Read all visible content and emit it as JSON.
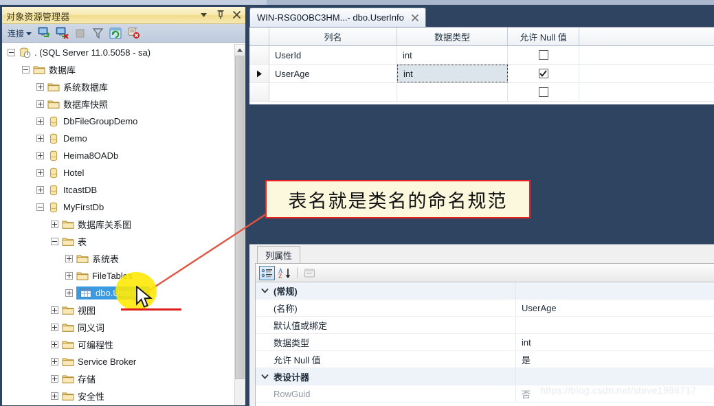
{
  "object_explorer": {
    "title": "对象资源管理器",
    "header_buttons": [
      {
        "name": "dropdown",
        "icon": "chevron-down-icon"
      },
      {
        "name": "pin",
        "icon": "pin-icon"
      },
      {
        "name": "close",
        "icon": "close-icon"
      }
    ],
    "toolbar": {
      "connect_label": "连接",
      "connect_caret": "▾",
      "icons": [
        "connect-icon",
        "disconnect-icon",
        "stop-icon",
        "filter-icon",
        "refresh-icon",
        "script-stop-icon"
      ]
    },
    "tree": [
      {
        "label": ". (SQL Server 11.0.5058 - sa)",
        "icon": "server-icon",
        "indent": 0,
        "expander": "minus",
        "selected": false
      },
      {
        "label": "数据库",
        "icon": "folder-icon",
        "indent": 1,
        "expander": "minus",
        "selected": false
      },
      {
        "label": "系统数据库",
        "icon": "folder-icon",
        "indent": 2,
        "expander": "plus",
        "selected": false
      },
      {
        "label": "数据库快照",
        "icon": "folder-icon",
        "indent": 2,
        "expander": "plus",
        "selected": false
      },
      {
        "label": "DbFileGroupDemo",
        "icon": "database-icon",
        "indent": 2,
        "expander": "plus",
        "selected": false
      },
      {
        "label": "Demo",
        "icon": "database-icon",
        "indent": 2,
        "expander": "plus",
        "selected": false
      },
      {
        "label": "Heima8OADb",
        "icon": "database-icon",
        "indent": 2,
        "expander": "plus",
        "selected": false
      },
      {
        "label": "Hotel",
        "icon": "database-icon",
        "indent": 2,
        "expander": "plus",
        "selected": false
      },
      {
        "label": "ItcastDB",
        "icon": "database-icon",
        "indent": 2,
        "expander": "plus",
        "selected": false
      },
      {
        "label": "MyFirstDb",
        "icon": "database-icon",
        "indent": 2,
        "expander": "minus",
        "selected": false
      },
      {
        "label": "数据库关系图",
        "icon": "folder-icon",
        "indent": 3,
        "expander": "plus",
        "selected": false
      },
      {
        "label": "表",
        "icon": "folder-icon",
        "indent": 3,
        "expander": "minus",
        "selected": false
      },
      {
        "label": "系统表",
        "icon": "folder-icon",
        "indent": 4,
        "expander": "plus",
        "selected": false
      },
      {
        "label": "FileTables",
        "icon": "folder-icon",
        "indent": 4,
        "expander": "plus",
        "selected": false
      },
      {
        "label": "dbo.UserInfo",
        "icon": "table-icon",
        "indent": 4,
        "expander": "plus",
        "selected": true
      },
      {
        "label": "视图",
        "icon": "folder-icon",
        "indent": 3,
        "expander": "plus",
        "selected": false
      },
      {
        "label": "同义词",
        "icon": "folder-icon",
        "indent": 3,
        "expander": "plus",
        "selected": false
      },
      {
        "label": "可编程性",
        "icon": "folder-icon",
        "indent": 3,
        "expander": "plus",
        "selected": false
      },
      {
        "label": "Service Broker",
        "icon": "folder-icon",
        "indent": 3,
        "expander": "plus",
        "selected": false
      },
      {
        "label": "存储",
        "icon": "folder-icon",
        "indent": 3,
        "expander": "plus",
        "selected": false
      },
      {
        "label": "安全性",
        "icon": "folder-icon",
        "indent": 3,
        "expander": "plus",
        "selected": false
      }
    ]
  },
  "editor": {
    "tab": {
      "title": "WIN-RSG0OBC3HM...- dbo.UserInfo",
      "close_icon": "close-icon"
    },
    "grid": {
      "columns": [
        "列名",
        "数据类型",
        "允许 Null 值"
      ],
      "rows": [
        {
          "row_indicator": "",
          "column_name": "UserId",
          "data_type": "int",
          "allow_nulls": false,
          "active_cell": null
        },
        {
          "row_indicator": "▶",
          "column_name": "UserAge",
          "data_type": "int",
          "allow_nulls": true,
          "active_cell": "data_type"
        },
        {
          "row_indicator": "",
          "column_name": "",
          "data_type": "",
          "allow_nulls": false,
          "active_cell": null
        }
      ]
    }
  },
  "annotation": {
    "text": "表名就是类名的命名规范",
    "border_color": "#ee2222",
    "background_color": "#fcf8de",
    "arrow_color": "#e0553f",
    "highlight_color": "#ffe800",
    "underline_color": "#e01b1b"
  },
  "properties": {
    "tab_label": "列属性",
    "toolbar_icons": [
      "categorized-view-icon",
      "alphabetical-sort-icon",
      "property-pages-icon"
    ],
    "groups": [
      {
        "name": "(常规)",
        "chevron": "chevron-down-icon",
        "rows": [
          {
            "name": "(名称)",
            "value": "UserAge",
            "dim": false
          },
          {
            "name": "默认值或绑定",
            "value": "",
            "dim": false
          },
          {
            "name": "数据类型",
            "value": "int",
            "dim": false
          },
          {
            "name": "允许 Null 值",
            "value": "是",
            "dim": false
          }
        ]
      },
      {
        "name": "表设计器",
        "chevron": "chevron-down-icon",
        "rows": [
          {
            "name": "RowGuid",
            "value": "否",
            "dim": true
          }
        ]
      }
    ]
  },
  "watermark": {
    "text": "https://blog.csdn.net/steve1988717"
  }
}
